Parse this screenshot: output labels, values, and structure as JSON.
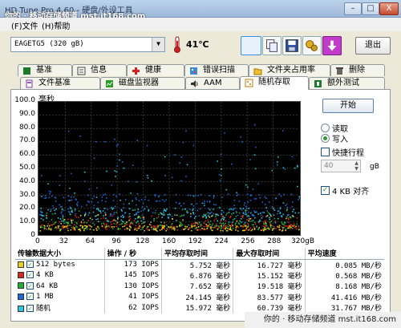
{
  "title": "HD Tune Pro 4.60 - 硬盘/外设工具",
  "watermark_top": "你的 · 移动存储频道  mst.it168.com",
  "window_controls": {
    "min": "–",
    "max": "□",
    "close": "X"
  },
  "menu": {
    "file": "(F)文件",
    "help": "(H)帮助"
  },
  "drive": {
    "selected": "EAGETG5  (320 gB)"
  },
  "temperature": "41℃",
  "exit_label": "退出",
  "tabs_row1": [
    {
      "label": "基准",
      "icon": "benchmark-icon"
    },
    {
      "label": "信息",
      "icon": "info-icon"
    },
    {
      "label": "健康",
      "icon": "health-cross-icon"
    },
    {
      "label": "错误扫描",
      "icon": "scan-icon"
    },
    {
      "label": "文件夹占用率",
      "icon": "folder-icon"
    },
    {
      "label": "删除",
      "icon": "trash-icon"
    }
  ],
  "tabs_row2": [
    {
      "label": "文件基准",
      "icon": "file-icon"
    },
    {
      "label": "磁盘监视器",
      "icon": "monitor-icon"
    },
    {
      "label": "AAM",
      "icon": "speaker-icon"
    },
    {
      "label": "随机存取",
      "icon": "random-icon",
      "active": true
    },
    {
      "label": "额外测试",
      "icon": "extra-icon"
    }
  ],
  "controls": {
    "start": "开始",
    "read": "读取",
    "write": "写入",
    "selected_mode": "write",
    "short_stroke": "快捷行程",
    "short_stroke_checked": false,
    "stroke_value": "40",
    "stroke_unit": "gB",
    "align_4kb": "4 KB 对齐",
    "align_4kb_checked": true
  },
  "chart_data": {
    "type": "scatter",
    "ylabel": "毫秒",
    "xlabel": "",
    "y_ticks": [
      "100.0",
      "90.0",
      "80.0",
      "70.0",
      "60.0",
      "50.0",
      "40.0",
      "30.0",
      "20.0",
      "10.0",
      "0"
    ],
    "x_ticks": [
      "0",
      "32",
      "64",
      "96",
      "128",
      "160",
      "192",
      "224",
      "256",
      "288",
      "320gB"
    ],
    "ylim": [
      0,
      100
    ],
    "xlim": [
      0,
      320
    ],
    "grid": true,
    "series": [
      {
        "name": "512 bytes",
        "color": "#e8d21a",
        "mean_ms": 5.752,
        "max_ms": 16.727
      },
      {
        "name": "4 KB",
        "color": "#d8261a",
        "mean_ms": 6.876,
        "max_ms": 15.152
      },
      {
        "name": "64 KB",
        "color": "#20b030",
        "mean_ms": 7.652,
        "max_ms": 19.518
      },
      {
        "name": "1 MB",
        "color": "#1a6ad8",
        "mean_ms": 24.145,
        "max_ms": 83.577
      },
      {
        "name": "随机",
        "color": "#28c8e0",
        "mean_ms": 15.972,
        "max_ms": 60.739
      }
    ]
  },
  "table": {
    "headers": [
      "传输数据大小",
      "操作 / 秒",
      "平均存取时间",
      "最大存取时间",
      "平均速度"
    ],
    "rows": [
      {
        "size": "512 bytes",
        "ops": "173 IOPS",
        "avg": "5.752  毫秒",
        "max": "16.727  毫秒",
        "speed": "0.085 MB/秒"
      },
      {
        "size": "4 KB",
        "ops": "145 IOPS",
        "avg": "6.876  毫秒",
        "max": "15.152  毫秒",
        "speed": "0.568 MB/秒"
      },
      {
        "size": "64 KB",
        "ops": "130 IOPS",
        "avg": "7.652  毫秒",
        "max": "19.518  毫秒",
        "speed": "8.168 MB/秒"
      },
      {
        "size": "1 MB",
        "ops": "41 IOPS",
        "avg": "24.145  毫秒",
        "max": "83.577  毫秒",
        "speed": "41.416 MB/秒"
      },
      {
        "size": "随机",
        "ops": "62 IOPS",
        "avg": "15.972  毫秒",
        "max": "60.739  毫秒",
        "speed": "31.767 MB/秒"
      }
    ]
  },
  "watermark_bottom": "你的 · 移动存储频道  mst.it168.com"
}
